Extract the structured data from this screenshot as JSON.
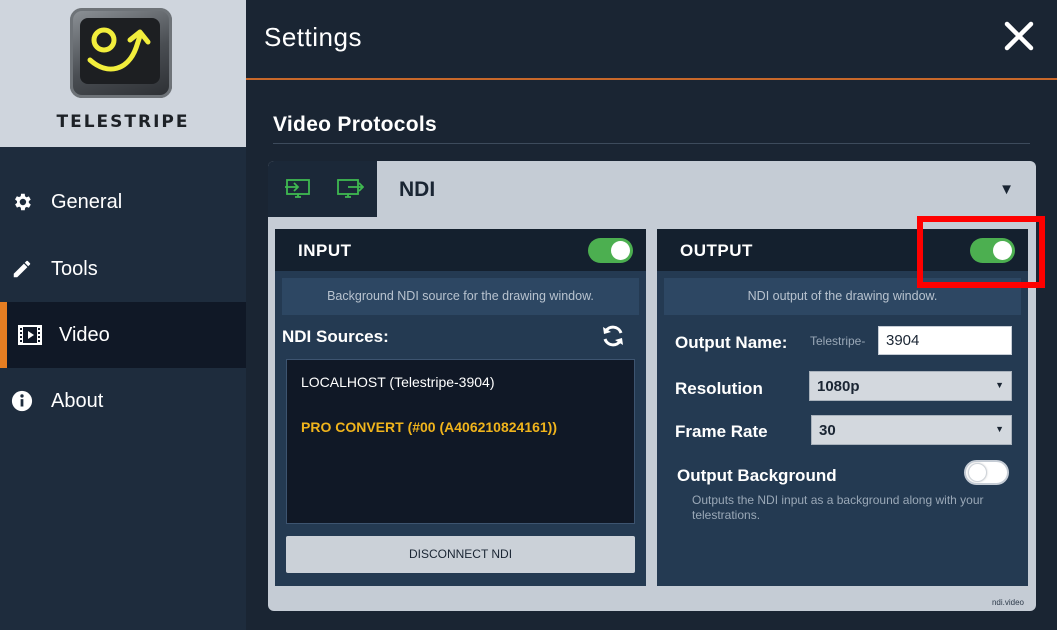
{
  "app": {
    "brand": "TELESTRIPE"
  },
  "header": {
    "title": "Settings"
  },
  "sidebar": {
    "items": [
      {
        "label": "General",
        "icon": "gear-icon"
      },
      {
        "label": "Tools",
        "icon": "pencil-icon"
      },
      {
        "label": "Video",
        "icon": "film-icon",
        "active": true
      },
      {
        "label": "About",
        "icon": "info-icon"
      }
    ]
  },
  "main": {
    "section_title": "Video Protocols",
    "protocol": {
      "selected": "NDI"
    },
    "input": {
      "title": "INPUT",
      "enabled": true,
      "description": "Background NDI source for the drawing window.",
      "sources_label": "NDI Sources:",
      "sources": [
        {
          "label": "LOCALHOST (Telestripe-3904)",
          "selected": false
        },
        {
          "label": "PRO CONVERT (#00 (A406210824161))",
          "selected": true
        }
      ],
      "disconnect_label": "DISCONNECT NDI"
    },
    "output": {
      "title": "OUTPUT",
      "enabled": true,
      "description": "NDI output of the drawing window.",
      "name_label": "Output Name:",
      "name_prefix": "Telestripe-",
      "name_value": "3904",
      "resolution_label": "Resolution",
      "resolution_value": "1080p",
      "frame_rate_label": "Frame Rate",
      "frame_rate_value": "30",
      "background_label": "Output Background",
      "background_enabled": false,
      "background_description": "Outputs the NDI input as a background along with your telestrations."
    },
    "footer": "ndi.video"
  },
  "colors": {
    "accent": "#e67e22",
    "toggle_on": "#4caf50",
    "selected_source": "#f0b41c",
    "highlight": "#ff0000"
  }
}
